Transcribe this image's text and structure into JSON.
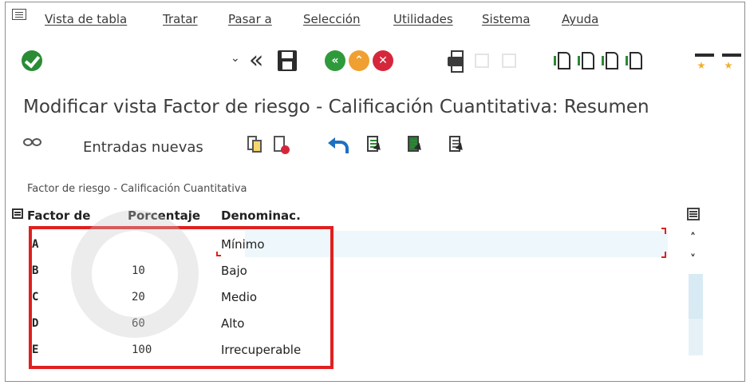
{
  "menu": {
    "items": [
      "Vista de tabla",
      "Tratar",
      "Pasar a",
      "Selección",
      "Utilidades",
      "Sistema",
      "Ayuda"
    ]
  },
  "page_title": "Modificar vista Factor de riesgo - Calificación Cuantitativa: Resumen",
  "app_toolbar": {
    "new_entries_label": "Entradas nuevas"
  },
  "section_label": "Factor de riesgo - Calificación Cuantitativa",
  "table": {
    "columns": [
      "Factor de",
      "Porcentaje",
      "Denominac."
    ],
    "rows": [
      {
        "key": "A",
        "pct": "",
        "den": "Mínimo"
      },
      {
        "key": "B",
        "pct": "10",
        "den": "Bajo"
      },
      {
        "key": "C",
        "pct": "20",
        "den": "Medio"
      },
      {
        "key": "D",
        "pct": "60",
        "den": "Alto"
      },
      {
        "key": "E",
        "pct": "100",
        "den": "Irrecuperable"
      }
    ]
  },
  "icons": {
    "toolbar": [
      "ok-icon",
      "chevron-down-icon",
      "back-double-icon",
      "save-icon",
      "back-icon",
      "exit-icon",
      "cancel-icon",
      "print-icon",
      "first-page-icon",
      "previous-page-icon",
      "next-page-icon",
      "last-page-icon",
      "create-session-icon",
      "shortcut-icon"
    ],
    "app_toolbar": [
      "display-change-icon",
      "copy-icon",
      "delete-icon",
      "undo-icon",
      "select-all-icon",
      "select-block-icon",
      "deselect-all-icon"
    ]
  },
  "colors": {
    "ok_green": "#2a8c36",
    "back_green": "#2f9a3c",
    "exit_orange": "#f0a030",
    "cancel_red": "#d6263b",
    "highlight_red": "#e02020",
    "selection_blue": "#eef7fb"
  },
  "nav_glyphs": {
    "back": "«",
    "exit": "⌃",
    "cancel": "✕",
    "double_back": "«",
    "small_chevron": "⌄",
    "scroll_up": "˄",
    "scroll_down": "˅"
  }
}
